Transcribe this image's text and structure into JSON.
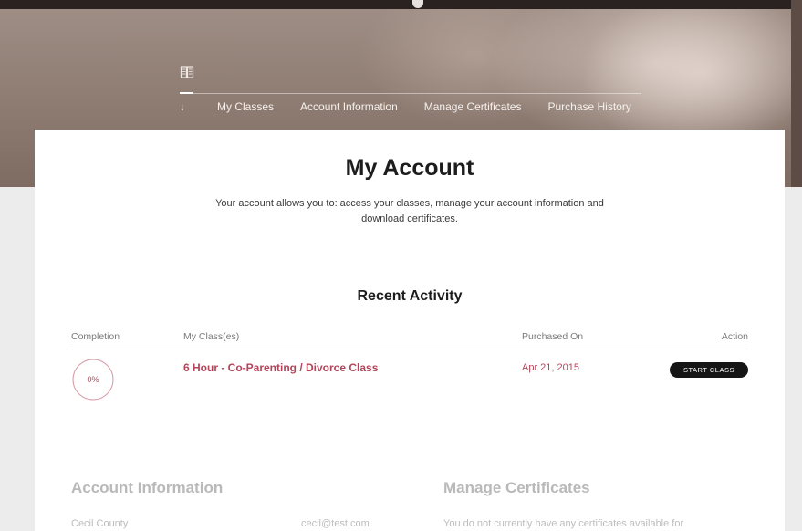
{
  "nav": {
    "tabs": [
      {
        "label": "My Classes"
      },
      {
        "label": "Account Information"
      },
      {
        "label": "Manage Certificates"
      },
      {
        "label": "Purchase History"
      }
    ]
  },
  "page": {
    "title": "My Account",
    "intro": "Your account allows you to: access your classes, manage your account information and download certificates."
  },
  "recent_activity": {
    "title": "Recent Activity",
    "columns": {
      "completion": "Completion",
      "classes": "My Class(es)",
      "purchased": "Purchased On",
      "action": "Action"
    },
    "rows": [
      {
        "completion": "0%",
        "completion_fraction": 0,
        "class_name": "6 Hour - Co-Parenting / Divorce Class",
        "purchased_on": "Apr 21, 2015",
        "action_label": "START CLASS"
      }
    ]
  },
  "account_info": {
    "title": "Account Information",
    "name": "Cecil County",
    "email": "cecil@test.com"
  },
  "certificates": {
    "title": "Manage Certificates",
    "message": "You do not currently have any certificates available for"
  },
  "colors": {
    "accent": "#b3455a",
    "button": "#151515",
    "hero": "#8e7c72"
  },
  "icons": [
    "book-icon",
    "arrow-down-icon"
  ]
}
